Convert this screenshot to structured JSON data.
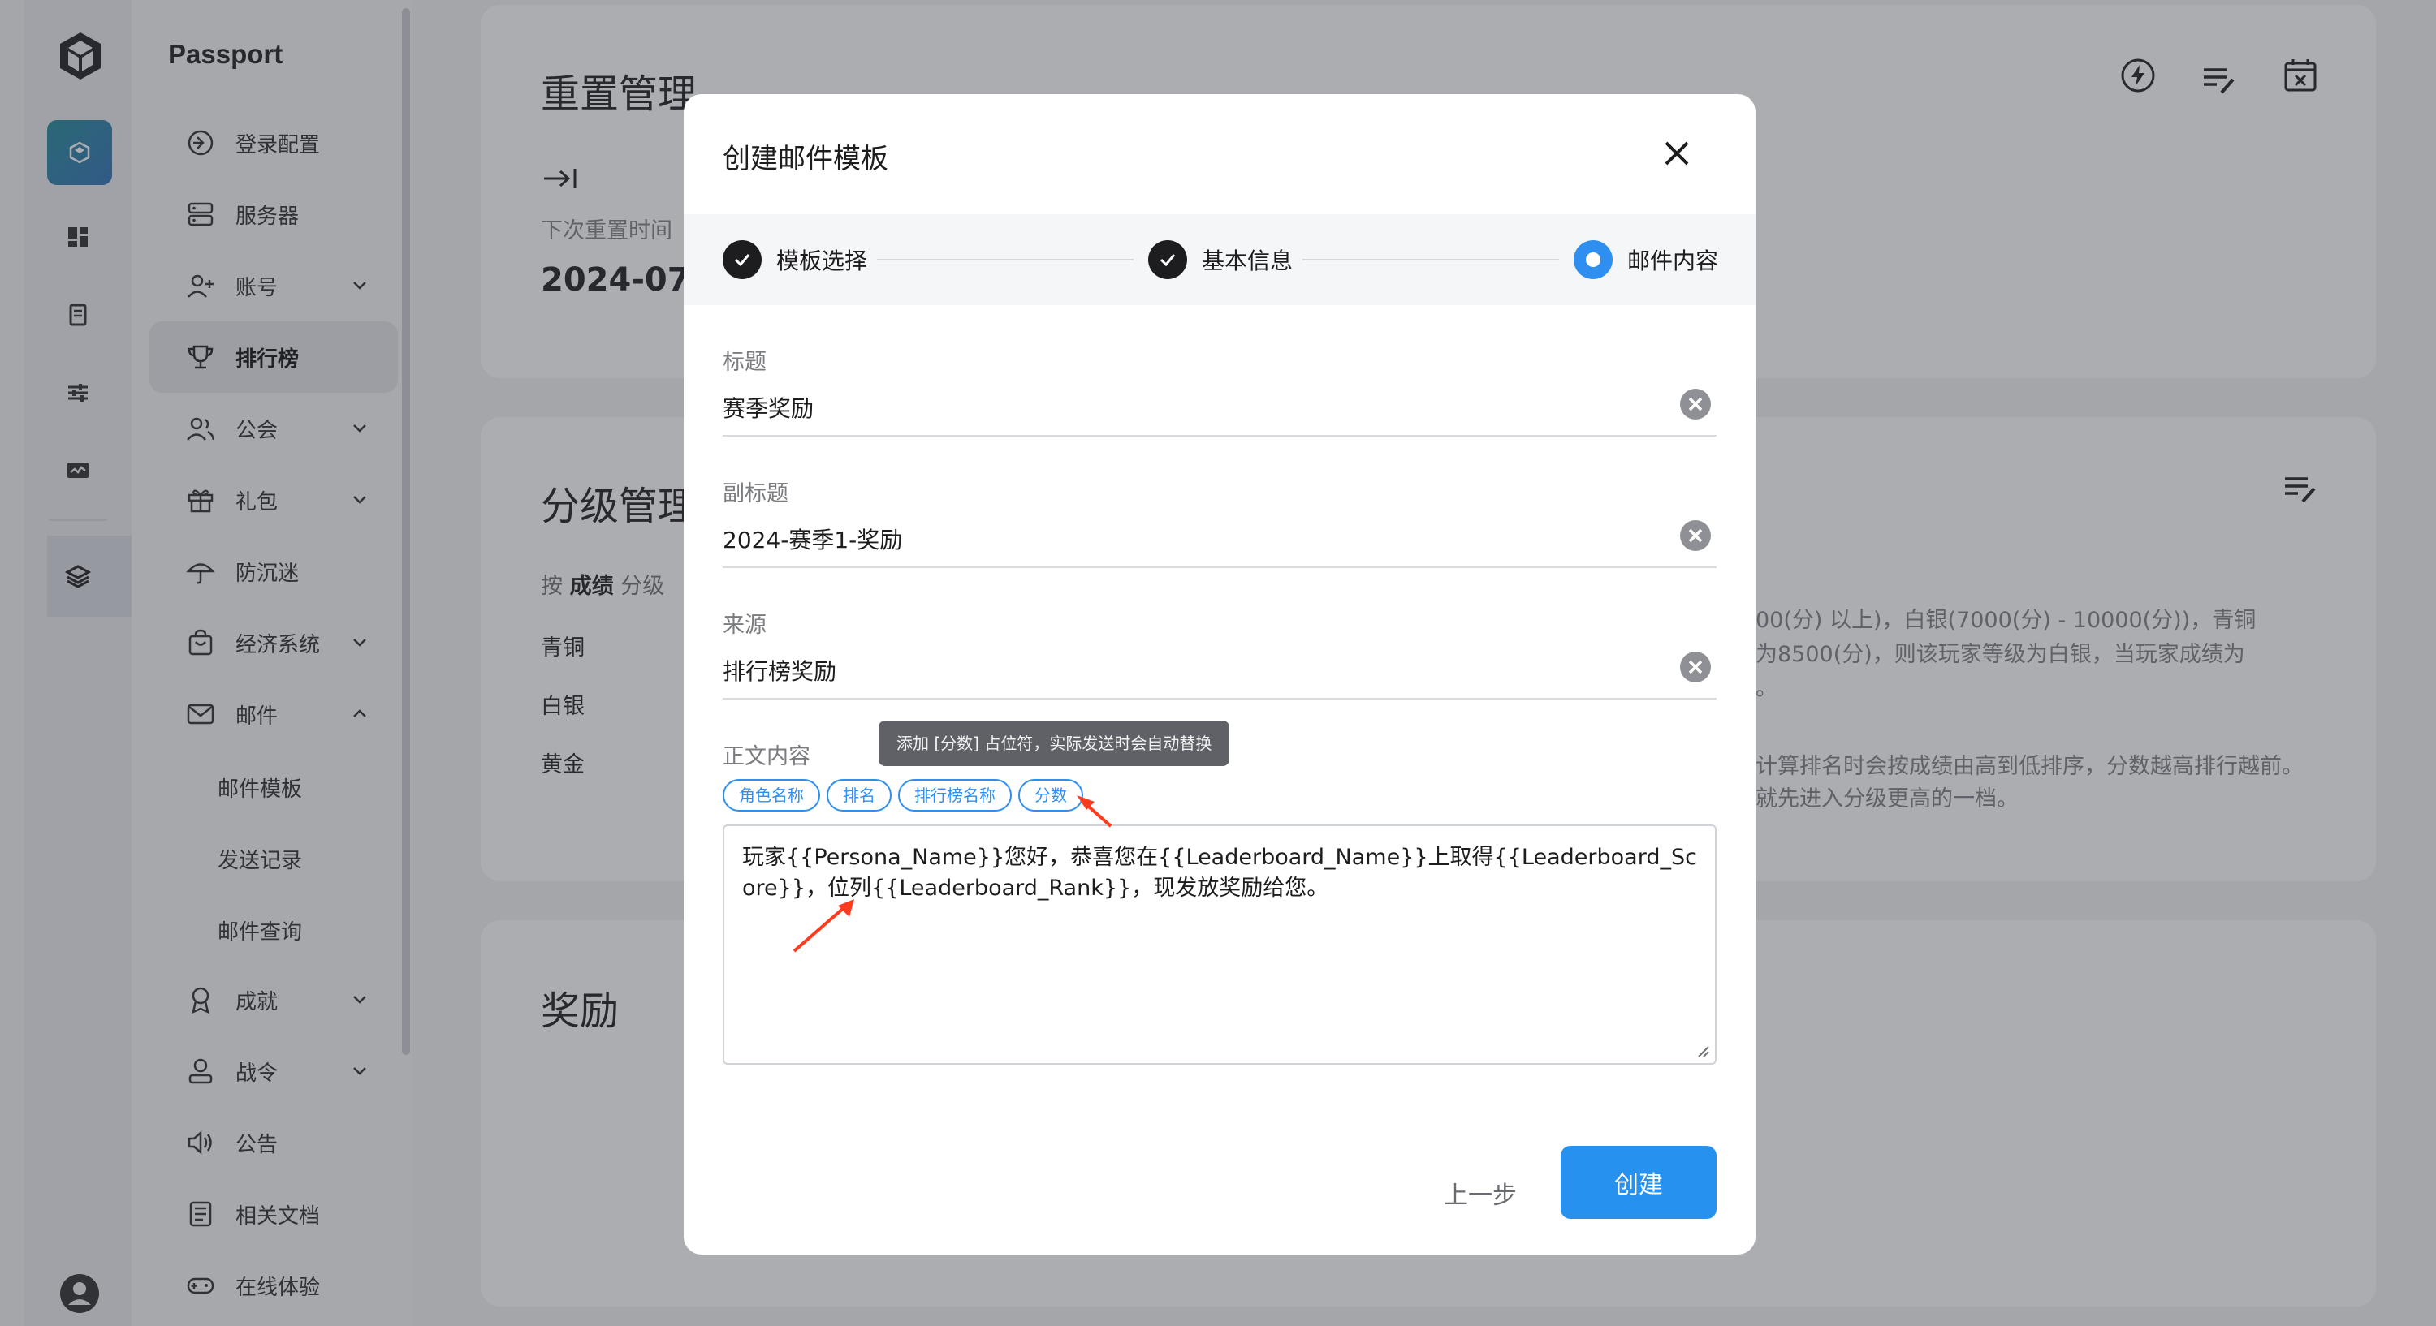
{
  "app": {
    "name": "Passport"
  },
  "colors": {
    "accent": "#2f8ff0",
    "primary_button": "#2791f0",
    "annotation_arrow": "#ff3b1f"
  },
  "rail": {
    "icons": [
      "unity-logo-icon",
      "app-icon",
      "dashboard-icon",
      "docs-icon",
      "sliders-icon",
      "monitor-icon",
      "layers-icon",
      "user-avatar-icon"
    ]
  },
  "sidebar": {
    "items": [
      {
        "label": "登录配置",
        "icon": "login-icon"
      },
      {
        "label": "服务器",
        "icon": "server-icon"
      },
      {
        "label": "账号",
        "icon": "user-add-icon",
        "expandable": true
      },
      {
        "label": "排行榜",
        "icon": "trophy-icon",
        "active": true
      },
      {
        "label": "公会",
        "icon": "group-icon",
        "expandable": true
      },
      {
        "label": "礼包",
        "icon": "gift-icon",
        "expandable": true
      },
      {
        "label": "防沉迷",
        "icon": "umbrella-icon"
      },
      {
        "label": "经济系统",
        "icon": "shop-bag-icon",
        "expandable": true
      },
      {
        "label": "邮件",
        "icon": "mail-icon",
        "expanded": true
      },
      {
        "label": "成就",
        "icon": "badge-icon",
        "expandable": true
      },
      {
        "label": "战令",
        "icon": "person-icon",
        "expandable": true
      },
      {
        "label": "公告",
        "icon": "speaker-icon"
      },
      {
        "label": "相关文档",
        "icon": "document-icon"
      },
      {
        "label": "在线体验",
        "icon": "gamepad-icon"
      }
    ],
    "mail_sub": [
      "邮件模板",
      "发送记录",
      "邮件查询"
    ]
  },
  "background": {
    "reset_card": {
      "title": "重置管理",
      "next_reset_label": "下次重置时间",
      "next_reset_value": "2024-07-"
    },
    "tier_card": {
      "title": "分级管理",
      "by_prefix": "按",
      "by_bold": "成绩",
      "by_suffix": "分级",
      "tiers": [
        "青铜",
        "白银",
        "黄金"
      ],
      "desc_line1": "00(分) 以上)，白银(7000(分) - 10000(分))，青铜",
      "desc_line2": "为8500(分)，则该玩家等级为白银，当玩家成绩为",
      "desc_line3": "。",
      "desc_line4": "计算排名时会按成绩由高到低排序，分数越高排行越前。",
      "desc_line5": "就先进入分级更高的一档。"
    },
    "reward_card": {
      "title": "奖励"
    }
  },
  "modal": {
    "title": "创建邮件模板",
    "steps": [
      {
        "label": "模板选择",
        "state": "done"
      },
      {
        "label": "基本信息",
        "state": "done"
      },
      {
        "label": "邮件内容",
        "state": "current"
      }
    ],
    "fields": {
      "title": {
        "label": "标题",
        "value": "赛季奖励"
      },
      "subtitle": {
        "label": "副标题",
        "value": "2024-赛季1-奖励"
      },
      "source": {
        "label": "来源",
        "value": "排行榜奖励"
      }
    },
    "body": {
      "label": "正文内容",
      "tooltip": "添加 [分数] 占位符，实际发送时会自动替换",
      "chips": [
        "角色名称",
        "排名",
        "排行榜名称",
        "分数"
      ],
      "content": "玩家{{Persona_Name}}您好，恭喜您在{{Leaderboard_Name}}上取得{{Leaderboard_Score}}，位列{{Leaderboard_Rank}}，现发放奖励给您。"
    },
    "buttons": {
      "prev": "上一步",
      "create": "创建"
    }
  }
}
